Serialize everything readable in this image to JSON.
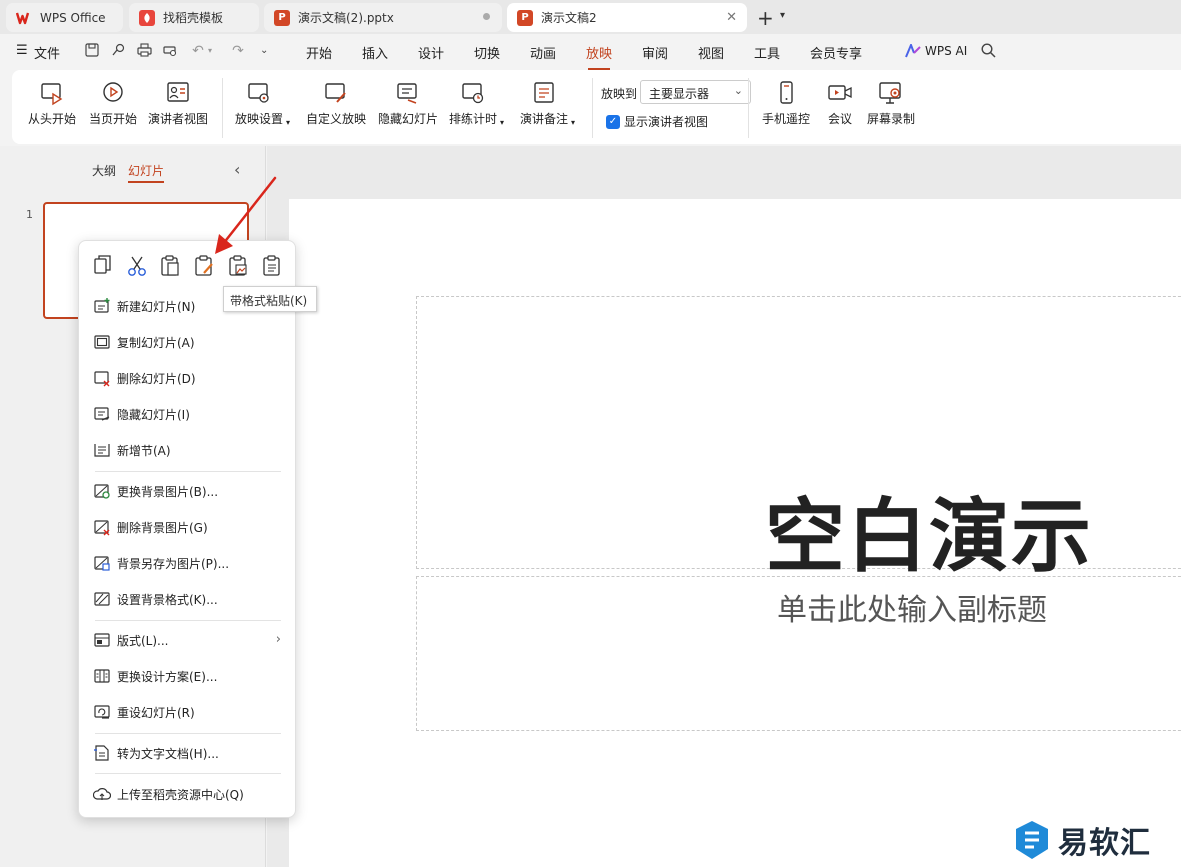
{
  "tabs": [
    {
      "label": "WPS Office",
      "icon": "wps-logo-icon"
    },
    {
      "label": "找稻壳模板",
      "icon": "docer-icon"
    },
    {
      "label": "演示文稿(2).pptx",
      "icon": "ppt-icon"
    },
    {
      "label": "演示文稿2",
      "icon": "ppt-icon"
    }
  ],
  "menu": {
    "file": "文件",
    "items": [
      "开始",
      "插入",
      "设计",
      "切换",
      "动画",
      "放映",
      "审阅",
      "视图",
      "工具",
      "会员专享"
    ],
    "active": "放映",
    "ai": "WPS AI"
  },
  "ribbon": {
    "from_start": "从头开始",
    "from_current": "当页开始",
    "presenter_view": "演讲者视图",
    "show_settings": "放映设置",
    "custom_show": "自定义放映",
    "hide_slide": "隐藏幻灯片",
    "rehearse": "排练计时",
    "notes": "演讲备注",
    "show_on_label": "放映到",
    "show_on_value": "主要显示器",
    "show_presenter": "显示演讲者视图",
    "phone_remote": "手机遥控",
    "meeting": "会议",
    "screen_record": "屏幕录制"
  },
  "left_pane": {
    "outline_tab": "大纲",
    "slides_tab": "幻灯片",
    "slide_number": "1"
  },
  "slide": {
    "title": "空白演示",
    "subtitle": "单击此处输入副标题"
  },
  "context_menu": {
    "toolbar_icons": [
      "copy-icon",
      "cut-icon",
      "paste-icon",
      "paste-with-format-icon",
      "paste-as-picture-icon",
      "paste-text-only-icon"
    ],
    "groups": [
      [
        {
          "label": "新建幻灯片(N)",
          "icon": "new-slide-icon"
        },
        {
          "label": "复制幻灯片(A)",
          "icon": "duplicate-slide-icon"
        },
        {
          "label": "删除幻灯片(D)",
          "icon": "delete-slide-icon"
        },
        {
          "label": "隐藏幻灯片(I)",
          "icon": "hide-slide-icon"
        },
        {
          "label": "新增节(A)",
          "icon": "add-section-icon"
        }
      ],
      [
        {
          "label": "更换背景图片(B)...",
          "icon": "change-background-icon"
        },
        {
          "label": "删除背景图片(G)",
          "icon": "delete-background-icon"
        },
        {
          "label": "背景另存为图片(P)...",
          "icon": "save-background-icon"
        },
        {
          "label": "设置背景格式(K)...",
          "icon": "format-background-icon"
        }
      ],
      [
        {
          "label": "版式(L)...",
          "icon": "layout-icon",
          "submenu": true
        },
        {
          "label": "更换设计方案(E)...",
          "icon": "change-design-icon"
        },
        {
          "label": "重设幻灯片(R)",
          "icon": "reset-slide-icon"
        }
      ],
      [
        {
          "label": "转为文字文档(H)...",
          "icon": "convert-to-doc-icon"
        }
      ],
      [
        {
          "label": "上传至稻壳资源中心(Q)",
          "icon": "upload-icon"
        }
      ]
    ]
  },
  "tooltip": "带格式粘贴(K)",
  "watermark": "易软汇",
  "colors": {
    "accent": "#c2431f",
    "arrow": "#d9261c",
    "ppt": "#d24726",
    "checkbox": "#1a73e8"
  }
}
